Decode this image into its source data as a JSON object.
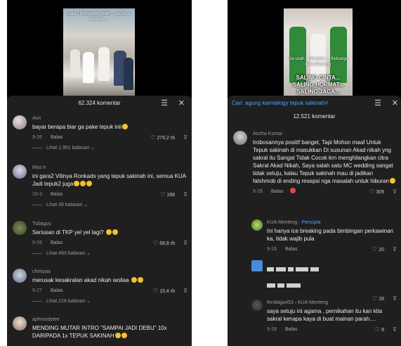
{
  "left": {
    "video_caption": "Gara2 Pengantin Inilah ... gara2 ... sakinah ...",
    "comment_count": "62.324 komentar",
    "comments": [
      {
        "user": "Ann",
        "text": "bayar berapa biar ga pake tepuk inii",
        "date": "9-26",
        "reply": "Balas",
        "likes": "279,2 rb",
        "more": "Lihat 1.951 balasan"
      },
      {
        "user": "Mas Ir",
        "text": "ini gara2 Vitinya Ronkads yang tepuk sakinah ini, semua KUA Jadi tepuk2 juga",
        "date": "10-3",
        "reply": "Balas",
        "likes": "168",
        "more": "Lihat 38 balasan"
      },
      {
        "user": "Tubagus",
        "text": "Seriusan di TKP yel yel lagi?",
        "date": "9-26",
        "reply": "Balas",
        "likes": "68,8 rb",
        "more": "Lihat 493 balasan"
      },
      {
        "user": "chintyaa",
        "text": "merusak kesakralan akad nikah woilaa",
        "date": "9-27",
        "reply": "Balas",
        "likes": "15,4 rb",
        "more": "Lihat 218 balasan"
      },
      {
        "user": "aphroodytee",
        "text": "MENDING MUTAR INTRO \"SAMPAI JADI DEBU\" 10x DARIPADA 1x TEPUK SAKINAH"
      }
    ]
  },
  "right": {
    "video_caption": "Ga usah... Gerakan ... Keluarga KUA Menteng",
    "video_slogan": [
      "SALING CINTA...",
      "SALING HORMAT...",
      "SALING JAGA..."
    ],
    "search_prefix": "Cari: ",
    "search_term": "agung karmalogy tepuk sakinah",
    "comment_count": "12.521 komentar",
    "comments": [
      {
        "user": "Ancha Kumar",
        "text": "trobosannya positif banget, Tapi Mohon maaf Untuk Tepuk sakinah di masukkan Di susunan Akad nikah yng sakral itu Sangat Tidak Cocok krn menghilangkan citra Sakral Akad Nikah, Saya salah satu MC wedding sangat tidak setuju, kalau Tepuk sakinah mau di jadikan falshmob di ending resepsi nga masalah untuk hiburan",
        "date": "9-28",
        "reply": "Balas",
        "likes": "309"
      },
      {
        "user": "KUA Menteng",
        "tag": "· Pencipta",
        "text": "Ini hanya ice breaking pada bimbingan perkawinan ka, tidak wajib pula",
        "date": "9-28",
        "reply": "Balas",
        "likes": "20"
      },
      {
        "likes": "28"
      },
      {
        "user": "fendiajja453",
        "tag": "› KUA Menteng",
        "text": "saya setuju ini agama , pernikahan itu kan kita sakral kenapa kaya di buat mainan parah....",
        "date": "9-28",
        "reply": "Balas",
        "likes": "8"
      }
    ]
  }
}
